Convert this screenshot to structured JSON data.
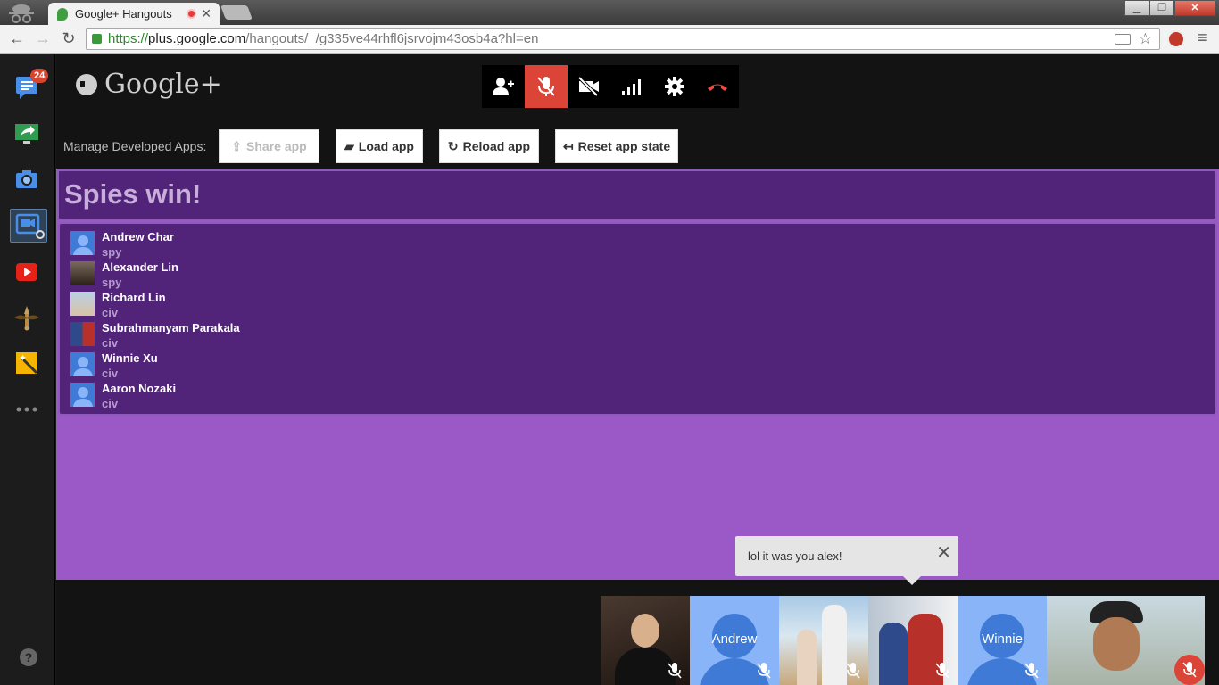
{
  "browser": {
    "tab_title": "Google+ Hangouts",
    "url_scheme": "https://",
    "url_host": "plus.google.com",
    "url_path": "/hangouts/_/g335ve44rhfl6jsrvojm43osb4a?hl=en"
  },
  "sidebar": {
    "chat_badge": "24",
    "help_label": "?"
  },
  "hangout": {
    "logo_text": "Google+"
  },
  "dev": {
    "label": "Manage Developed Apps:",
    "share_app": "Share app",
    "load_app": "Load app",
    "reload_app": "Reload app",
    "reset_app_state": "Reset app state"
  },
  "app": {
    "result_title": "Spies win!",
    "players": [
      {
        "name": "Andrew Char",
        "role": "spy"
      },
      {
        "name": "Alexander Lin",
        "role": "spy"
      },
      {
        "name": "Richard Lin",
        "role": "civ"
      },
      {
        "name": "Subrahmanyam Parakala",
        "role": "civ"
      },
      {
        "name": "Winnie Xu",
        "role": "civ"
      },
      {
        "name": "Aaron Nozaki",
        "role": "civ"
      }
    ]
  },
  "chat": {
    "message": "lol it was you alex!"
  },
  "filmstrip": {
    "labels": [
      "Andrew",
      "Winnie"
    ]
  },
  "colors": {
    "app_bg": "#9b59c8",
    "panel_bg": "#51247a",
    "mute_red": "#db4437"
  }
}
